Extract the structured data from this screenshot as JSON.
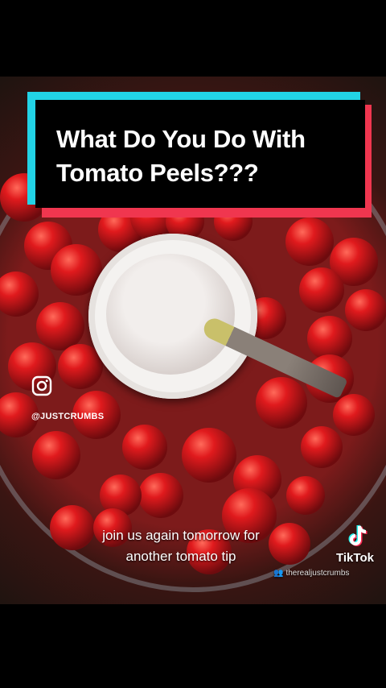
{
  "title": "What Do You Do With\nTomato Peels???",
  "instagram": {
    "icon": "instagram-icon",
    "handle": "@JUSTCRUMBS"
  },
  "caption": "join us again tomorrow for\nanother tomato tip",
  "tiktok": {
    "icon": "tiktok-logo-icon",
    "label": "TikTok",
    "username": "therealjustcrumbs"
  },
  "colors": {
    "title_bg": "#000000",
    "accent_cyan": "#22d3e6",
    "accent_red": "#f0364f",
    "tomato": "#d8161b"
  }
}
